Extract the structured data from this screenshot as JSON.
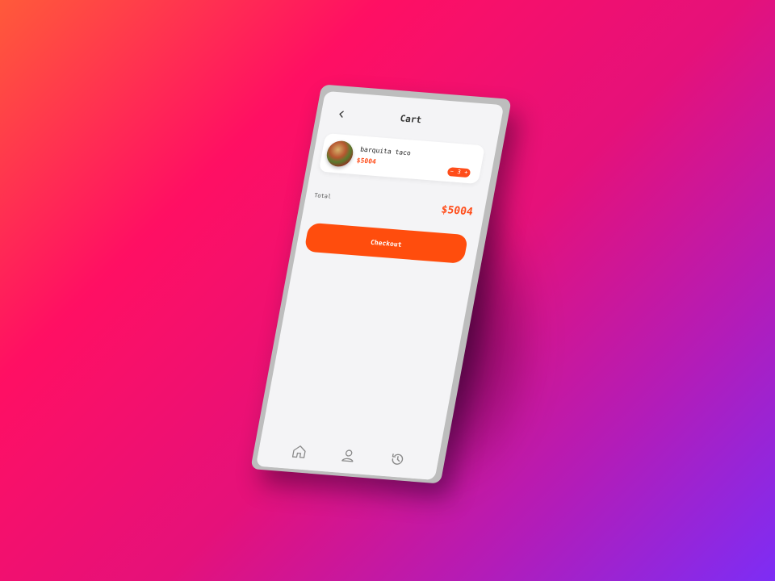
{
  "header": {
    "title": "Cart",
    "back_icon": "chevron-left-icon"
  },
  "cart": {
    "items": [
      {
        "name": "barquita taco",
        "price": "$5004",
        "quantity": "3",
        "minus_label": "−",
        "plus_label": "+"
      }
    ]
  },
  "summary": {
    "total_label": "Total",
    "total_value": "$5004"
  },
  "actions": {
    "checkout_label": "Checkout"
  },
  "bottom_nav": {
    "items": [
      {
        "icon": "home-icon"
      },
      {
        "icon": "user-icon"
      },
      {
        "icon": "history-icon"
      }
    ]
  },
  "colors": {
    "accent": "#ff4d0d",
    "screen_bg": "#f4f4f6",
    "text": "#333333"
  }
}
